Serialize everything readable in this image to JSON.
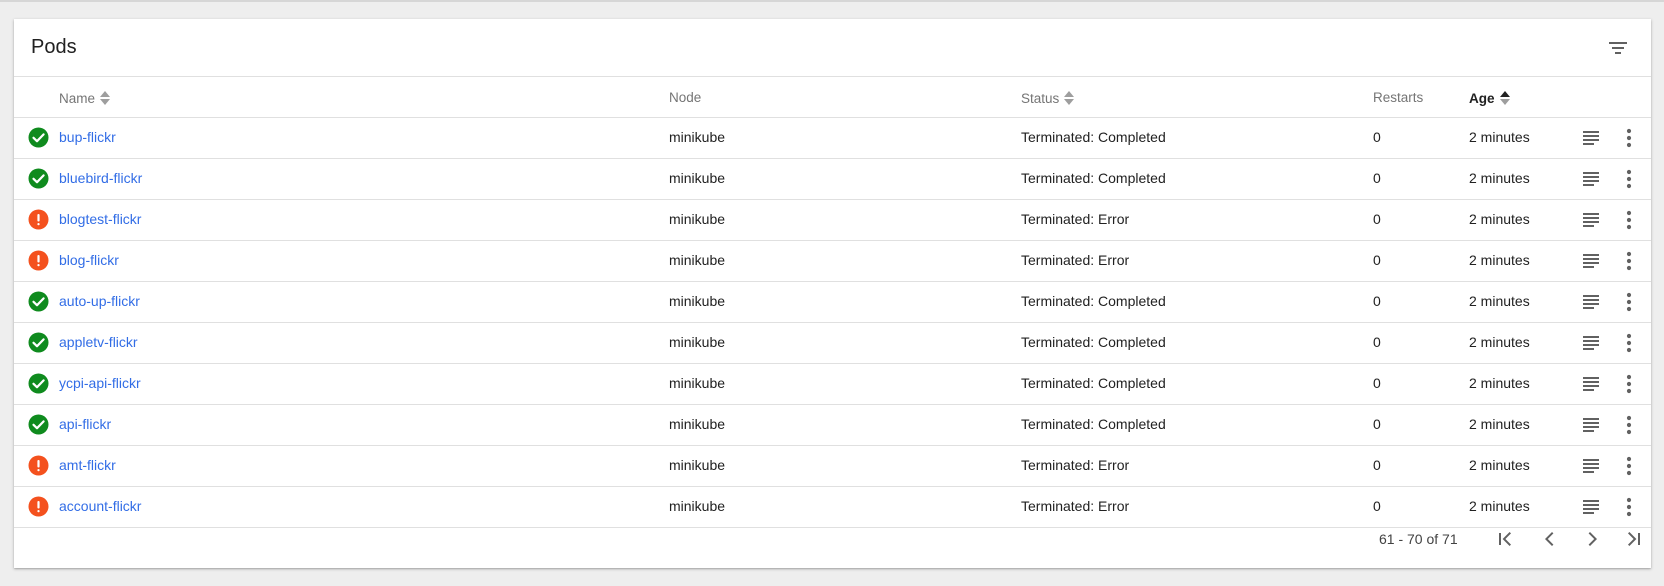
{
  "card": {
    "title": "Pods"
  },
  "columns": {
    "name": "Name",
    "node": "Node",
    "status": "Status",
    "restarts": "Restarts",
    "age": "Age"
  },
  "rows": [
    {
      "state": "ok",
      "name": "bup-flickr",
      "node": "minikube",
      "status": "Terminated: Completed",
      "restarts": "0",
      "age": "2 minutes"
    },
    {
      "state": "ok",
      "name": "bluebird-flickr",
      "node": "minikube",
      "status": "Terminated: Completed",
      "restarts": "0",
      "age": "2 minutes"
    },
    {
      "state": "error",
      "name": "blogtest-flickr",
      "node": "minikube",
      "status": "Terminated: Error",
      "restarts": "0",
      "age": "2 minutes"
    },
    {
      "state": "error",
      "name": "blog-flickr",
      "node": "minikube",
      "status": "Terminated: Error",
      "restarts": "0",
      "age": "2 minutes"
    },
    {
      "state": "ok",
      "name": "auto-up-flickr",
      "node": "minikube",
      "status": "Terminated: Completed",
      "restarts": "0",
      "age": "2 minutes"
    },
    {
      "state": "ok",
      "name": "appletv-flickr",
      "node": "minikube",
      "status": "Terminated: Completed",
      "restarts": "0",
      "age": "2 minutes"
    },
    {
      "state": "ok",
      "name": "ycpi-api-flickr",
      "node": "minikube",
      "status": "Terminated: Completed",
      "restarts": "0",
      "age": "2 minutes"
    },
    {
      "state": "ok",
      "name": "api-flickr",
      "node": "minikube",
      "status": "Terminated: Completed",
      "restarts": "0",
      "age": "2 minutes"
    },
    {
      "state": "error",
      "name": "amt-flickr",
      "node": "minikube",
      "status": "Terminated: Error",
      "restarts": "0",
      "age": "2 minutes"
    },
    {
      "state": "error",
      "name": "account-flickr",
      "node": "minikube",
      "status": "Terminated: Error",
      "restarts": "0",
      "age": "2 minutes"
    }
  ],
  "pagination": {
    "range_text": "61 - 70 of 71"
  },
  "icons": {
    "filter": "filter-list-icon",
    "sort": "sort-arrows-icon",
    "ok": "check-circle-icon",
    "error": "error-circle-icon",
    "logs": "logs-icon",
    "menu": "more-vert-icon",
    "first": "first-page-icon",
    "prev": "chevron-left-icon",
    "next": "chevron-right-icon",
    "last": "last-page-icon"
  },
  "colors": {
    "ok": "#0f8b1e",
    "error": "#f4511e",
    "link": "#326de6",
    "icon": "#616161"
  }
}
